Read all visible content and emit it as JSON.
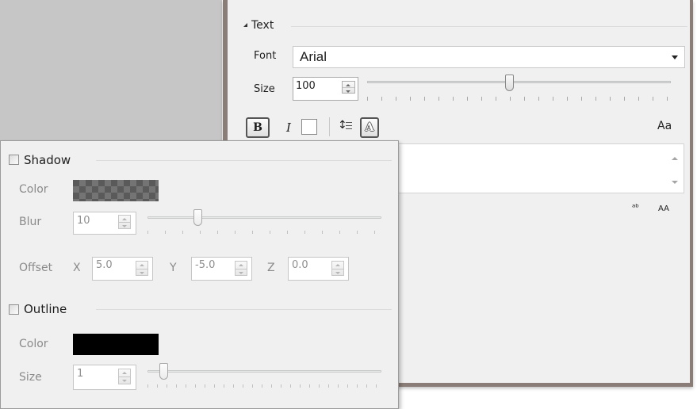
{
  "text_group": {
    "title": "Text",
    "font_label": "Font",
    "font_value": "Arial",
    "size_label": "Size",
    "size_value": "100",
    "size_slider_fraction": 0.47,
    "format_buttons": {
      "bold": "B",
      "italic": "I",
      "shadow_a": "A",
      "case": "Aa"
    },
    "small_buttons": {
      "spacing": "ᵃᵇ",
      "caps": "AA"
    }
  },
  "shadow": {
    "title": "Shadow",
    "checked": false,
    "color_label": "Color",
    "color": "#5a5a5a",
    "blur_label": "Blur",
    "blur_value": "10",
    "blur_slider_fraction": 0.25,
    "offset_label": "Offset",
    "x_label": "X",
    "x_value": "5.0",
    "y_label": "Y",
    "y_value": "-5.0",
    "z_label": "Z",
    "z_value": "0.0"
  },
  "outline": {
    "title": "Outline",
    "checked": false,
    "color_label": "Color",
    "color": "#000000",
    "size_label": "Size",
    "size_value": "1",
    "size_slider_fraction": 0.07
  }
}
